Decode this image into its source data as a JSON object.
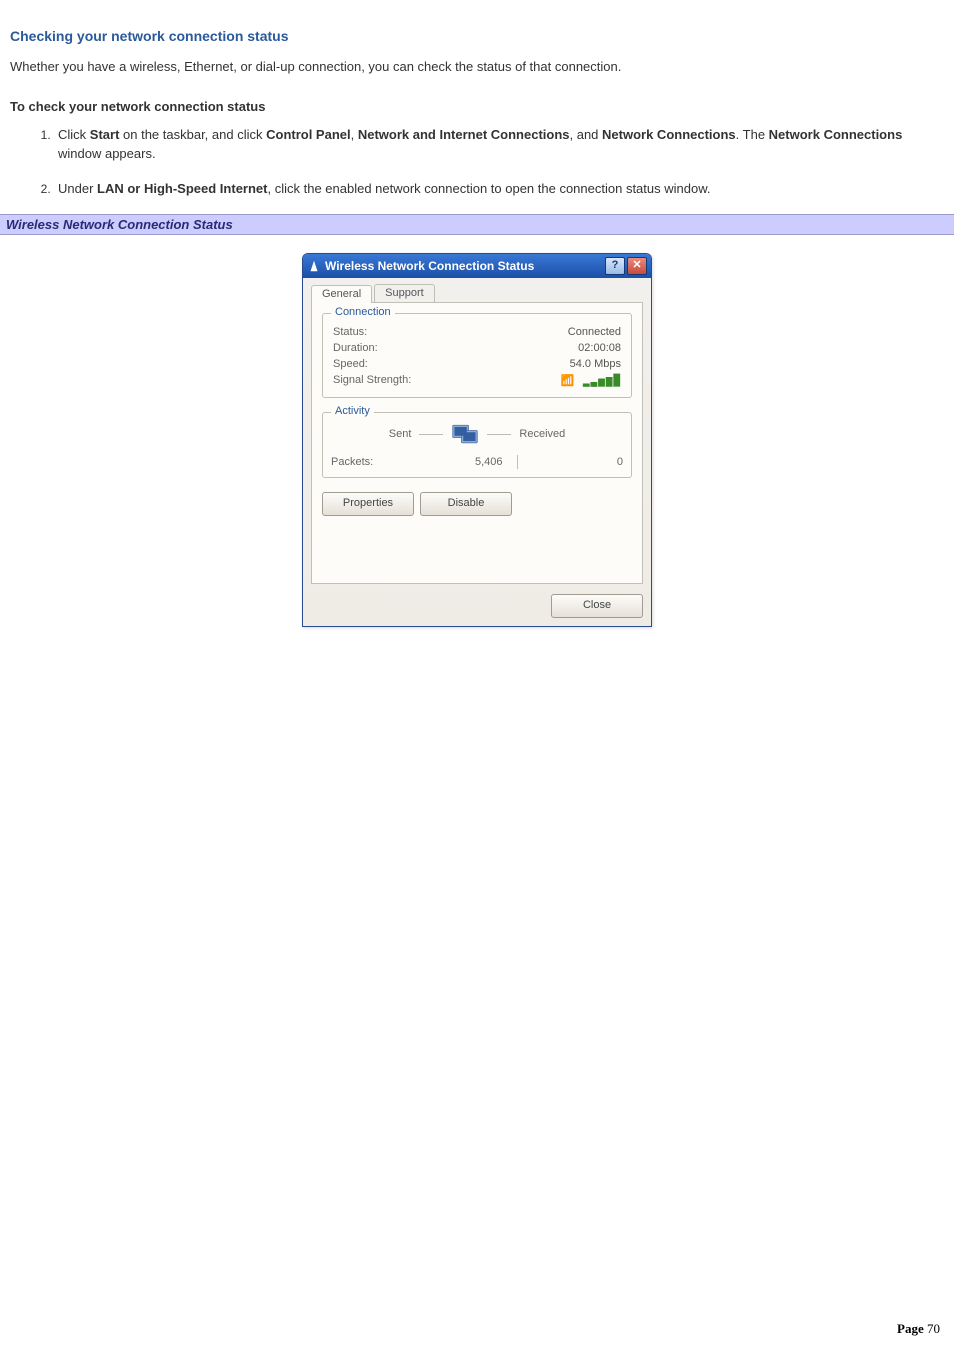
{
  "section_title": "Checking your network connection status",
  "intro": "Whether you have a wireless, Ethernet, or dial-up connection, you can check the status of that connection.",
  "subhead": "To check your network connection status",
  "steps": {
    "s1": {
      "pre": "Click ",
      "b1": "Start",
      "mid1": " on the taskbar, and click ",
      "b2": "Control Panel",
      "sep1": ", ",
      "b3": "Network and Internet Connections",
      "sep2": ", and ",
      "b4": "Network Connections",
      "mid2": ". The ",
      "b5": "Network Connections",
      "post": " window appears."
    },
    "s2": {
      "pre": "Under ",
      "b1": "LAN or High-Speed Internet",
      "post": ", click the enabled network connection to open the connection status window."
    }
  },
  "caption": "Wireless Network Connection Status",
  "dialog": {
    "title": "Wireless Network Connection Status",
    "help_glyph": "?",
    "close_glyph": "✕",
    "tabs": {
      "general": "General",
      "support": "Support"
    },
    "connection": {
      "legend": "Connection",
      "rows": {
        "status": {
          "label": "Status:",
          "value": "Connected"
        },
        "duration": {
          "label": "Duration:",
          "value": "02:00:08"
        },
        "speed": {
          "label": "Speed:",
          "value": "54.0 Mbps"
        },
        "signal": {
          "label": "Signal Strength:",
          "value": "▂▃▅▆█",
          "icon_glyph": "📶"
        }
      }
    },
    "activity": {
      "legend": "Activity",
      "sent_label": "Sent",
      "received_label": "Received",
      "packets_label": "Packets:",
      "packets_sent": "5,406",
      "packets_received": "0"
    },
    "buttons": {
      "properties": "Properties",
      "disable": "Disable",
      "close": "Close"
    }
  },
  "page_number": {
    "label": "Page ",
    "value": "70"
  }
}
